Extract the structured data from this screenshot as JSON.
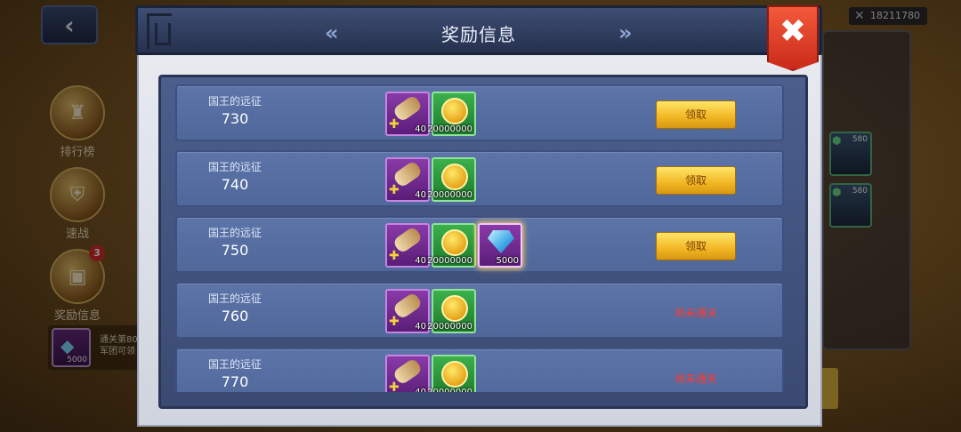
{
  "background": {
    "sidebar": [
      {
        "label": "排行榜"
      },
      {
        "label": "速战"
      },
      {
        "label": "奖励信息",
        "badge": "3"
      }
    ],
    "quest": {
      "line1": "通关第80",
      "line2": "军团可领",
      "gem_qty": "5000"
    },
    "score": "18211780",
    "right_cards": [
      {
        "level": "580"
      },
      {
        "level": "580"
      }
    ]
  },
  "modal": {
    "title": "奖励信息",
    "close_glyph": "✖",
    "nav_left": "«",
    "nav_right": "»"
  },
  "rewards": [
    {
      "label": "国王的远征",
      "level": "730",
      "items": [
        {
          "type": "scroll",
          "qty": "40"
        },
        {
          "type": "gold",
          "qty": "20000000"
        }
      ],
      "action": "领取",
      "claimable": true
    },
    {
      "label": "国王的远征",
      "level": "740",
      "items": [
        {
          "type": "scroll",
          "qty": "40"
        },
        {
          "type": "gold",
          "qty": "20000000"
        }
      ],
      "action": "领取",
      "claimable": true
    },
    {
      "label": "国王的远征",
      "level": "750",
      "items": [
        {
          "type": "scroll",
          "qty": "40"
        },
        {
          "type": "gold",
          "qty": "20000000"
        },
        {
          "type": "diamond",
          "qty": "5000"
        }
      ],
      "action": "领取",
      "claimable": true
    },
    {
      "label": "国王的远征",
      "level": "760",
      "items": [
        {
          "type": "scroll",
          "qty": "40"
        },
        {
          "type": "gold",
          "qty": "20000000"
        }
      ],
      "action": "尚未通关",
      "claimable": false
    },
    {
      "label": "国王的远征",
      "level": "770",
      "items": [
        {
          "type": "scroll",
          "qty": "40"
        },
        {
          "type": "gold",
          "qty": "20000000"
        }
      ],
      "action": "尚未通关",
      "claimable": false
    }
  ],
  "colors": {
    "claim_button": "#f2b623",
    "locked_text": "#ff3b2f",
    "row_bg": "#5c74a8"
  }
}
